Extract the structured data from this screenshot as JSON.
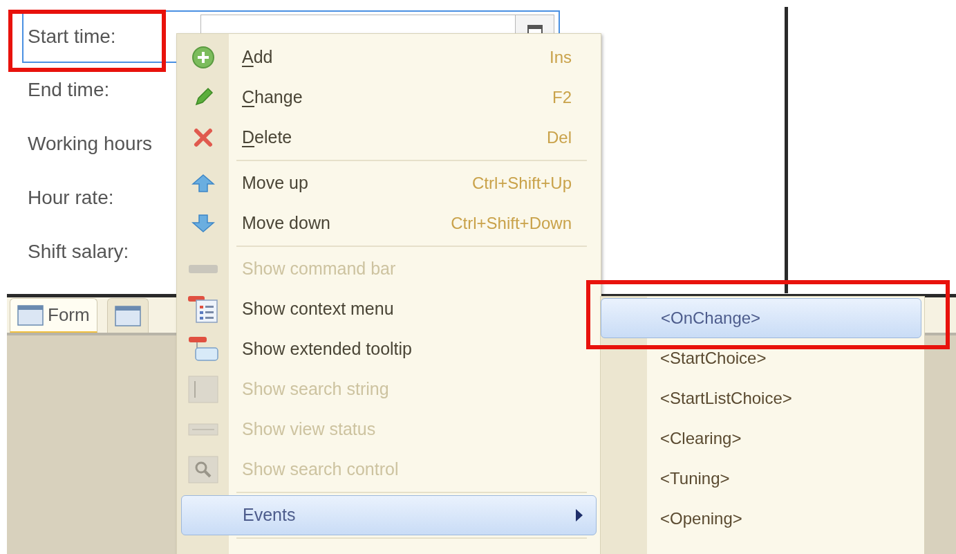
{
  "form": {
    "fields": [
      {
        "label": "Start time:",
        "focused": true
      },
      {
        "label": "End time:",
        "focused": false
      },
      {
        "label": "Working hours",
        "focused": false
      },
      {
        "label": "Hour rate:",
        "focused": false
      },
      {
        "label": "Shift salary:",
        "focused": false
      }
    ]
  },
  "tabs": [
    {
      "label": "Form",
      "selected": true
    },
    {
      "selected": false
    }
  ],
  "context_menu": {
    "items": [
      {
        "kind": "item",
        "label": "Add",
        "mnemonic": true,
        "shortcut": "Ins",
        "disabled": false,
        "selected": false
      },
      {
        "kind": "item",
        "label": "Change",
        "mnemonic": true,
        "shortcut": "F2",
        "disabled": false,
        "selected": false
      },
      {
        "kind": "item",
        "label": "Delete",
        "mnemonic": true,
        "shortcut": "Del",
        "disabled": false,
        "selected": false
      },
      {
        "kind": "separator"
      },
      {
        "kind": "item",
        "label": "Move up",
        "mnemonic": false,
        "shortcut": "Ctrl+Shift+Up",
        "disabled": false,
        "selected": false
      },
      {
        "kind": "item",
        "label": "Move down",
        "mnemonic": false,
        "shortcut": "Ctrl+Shift+Down",
        "disabled": false,
        "selected": false
      },
      {
        "kind": "separator"
      },
      {
        "kind": "item",
        "label": "Show command bar",
        "mnemonic": false,
        "disabled": true,
        "selected": false
      },
      {
        "kind": "item",
        "label": "Show context menu",
        "mnemonic": false,
        "disabled": false,
        "selected": false
      },
      {
        "kind": "item",
        "label": "Show extended tooltip",
        "mnemonic": false,
        "disabled": false,
        "selected": false
      },
      {
        "kind": "item",
        "label": "Show search string",
        "mnemonic": false,
        "disabled": true,
        "selected": false
      },
      {
        "kind": "item",
        "label": "Show view status",
        "mnemonic": false,
        "disabled": true,
        "selected": false
      },
      {
        "kind": "item",
        "label": "Show search control",
        "mnemonic": false,
        "disabled": true,
        "selected": false
      },
      {
        "kind": "separator"
      },
      {
        "kind": "submenu",
        "label": "Events",
        "mnemonic": false,
        "disabled": false,
        "selected": true
      },
      {
        "kind": "separator"
      }
    ]
  },
  "events_submenu": {
    "items": [
      {
        "label": "<OnChange>",
        "selected": true
      },
      {
        "label": "<StartChoice>",
        "selected": false
      },
      {
        "label": "<StartListChoice>",
        "selected": false
      },
      {
        "label": "<Clearing>",
        "selected": false
      },
      {
        "label": "<Tuning>",
        "selected": false
      },
      {
        "label": "<Opening>",
        "selected": false
      }
    ]
  }
}
